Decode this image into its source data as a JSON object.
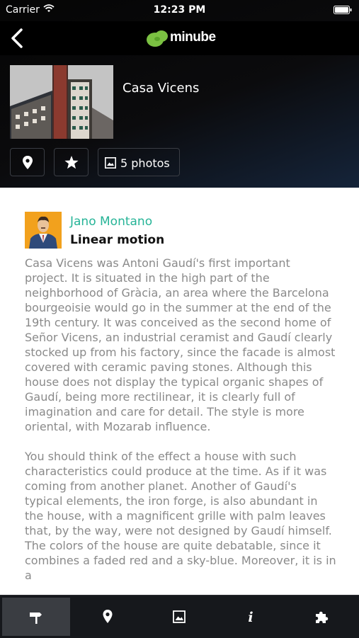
{
  "status_bar": {
    "carrier": "Carrier",
    "time": "12:23 PM",
    "wifi_icon": "wifi-icon",
    "battery_icon": "battery-icon"
  },
  "nav": {
    "back_icon": "chevron-left-icon",
    "logo_text": "minube",
    "logo_color": "#7bc142"
  },
  "place": {
    "name": "Casa Vicens",
    "actions": {
      "location_icon": "map-pin-icon",
      "favorite_icon": "star-icon",
      "photos_icon": "image-icon",
      "photos_label": "5 photos"
    }
  },
  "review": {
    "author": "Jano Montano",
    "title": "Linear motion",
    "paragraphs": [
      "Casa Vicens was Antoni Gaudí's first important project. It is situated in the high part of the neighborhood of Gràcia, an area where the Barcelona bourgeoisie would go in the summer at the end of the 19th century. It was conceived as the second home of Señor Vicens, an industrial ceramist and Gaudí clearly stocked up from his factory, since the facade is almost covered with ceramic paving stones. Although this house does not display the typical organic shapes of Gaudí, being more rectilinear, it is clearly full of imagination and care for detail. The style is more oriental, with Mozarab influence.",
      "You should think of the effect a house with such characteristics could produce at the time. As if it was coming from another planet. Another of Gaudí's typical elements, the iron forge, is also abundant in the house, with a magnificent grille with palm leaves that, by the way, were not designed by Gaudí himself. The colors of the house are quite debatable, since it combines a faded red and a sky-blue. Moreover, it is in a"
    ],
    "author_color": "#26b497"
  },
  "tab_bar": {
    "tabs": [
      {
        "icon": "signpost-icon",
        "active": true
      },
      {
        "icon": "map-pin-icon",
        "active": false
      },
      {
        "icon": "image-icon",
        "active": false
      },
      {
        "icon": "info-icon",
        "active": false
      },
      {
        "icon": "puzzle-icon",
        "active": false
      }
    ]
  }
}
